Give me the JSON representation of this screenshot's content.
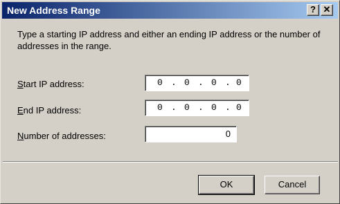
{
  "window": {
    "title": "New Address Range",
    "help_glyph": "?",
    "close_glyph": "✕"
  },
  "instructions": "Type a starting IP address and either an ending IP address or the number of addresses in the range.",
  "fields": {
    "start_ip": {
      "label_mnemonic": "S",
      "label_rest": "tart IP address:",
      "octets": [
        "0",
        "0",
        "0",
        "0"
      ]
    },
    "end_ip": {
      "label_mnemonic": "E",
      "label_rest": "nd IP address:",
      "octets": [
        "0",
        "0",
        "0",
        "0"
      ]
    },
    "number": {
      "label_mnemonic": "N",
      "label_rest": "umber of addresses:",
      "value": "0"
    }
  },
  "buttons": {
    "ok": "OK",
    "cancel": "Cancel"
  },
  "colors": {
    "titlebar_start": "#0a246a",
    "titlebar_end": "#a6caf0",
    "dialog_face": "#d4d0c8"
  }
}
